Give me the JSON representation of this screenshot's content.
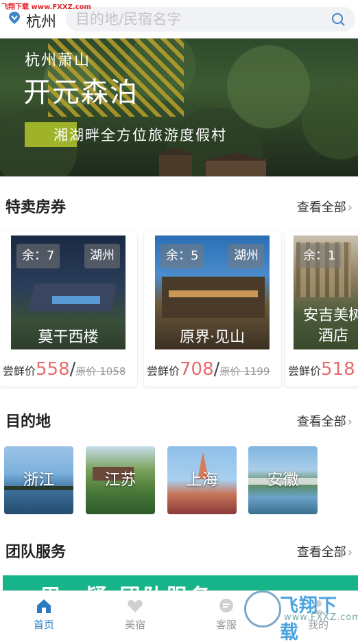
{
  "watermark_top": "飞翔下载 www.FXXZ.com",
  "header": {
    "city": "杭州",
    "search_placeholder": "目的地/民宿名字"
  },
  "banner": {
    "subtitle": "杭州萧山",
    "title": "开元森泊",
    "tagline": "湘湖畔全方位旅游度假村",
    "dot_count": 8
  },
  "deals": {
    "title": "特卖房券",
    "more": "查看全部",
    "items": [
      {
        "remain": "余：7",
        "region": "湖州",
        "name": "莫干西楼",
        "price_label": "尝鲜价",
        "price": "558",
        "slash": "/",
        "orig": "原价 1058"
      },
      {
        "remain": "余：5",
        "region": "湖州",
        "name": "原界·见山",
        "price_label": "尝鲜价",
        "price": "708",
        "slash": "/",
        "orig": "原价 1199"
      },
      {
        "remain": "余：1",
        "region": "",
        "name": "安吉美树酒店",
        "price_label": "尝鲜价",
        "price": "518",
        "slash": "",
        "orig": ""
      }
    ]
  },
  "destinations": {
    "title": "目的地",
    "more": "查看全部",
    "items": [
      {
        "name": "浙江"
      },
      {
        "name": "江苏"
      },
      {
        "name": "上海"
      },
      {
        "name": "安徽"
      }
    ]
  },
  "team": {
    "title": "团队服务",
    "more": "查看全部",
    "banner_text": "一用一疑 团队服务"
  },
  "tabs": [
    {
      "label": "首页",
      "active": true
    },
    {
      "label": "美宿",
      "active": false
    },
    {
      "label": "客服",
      "active": false
    },
    {
      "label": "我的",
      "active": false
    }
  ],
  "watermark_logo": {
    "text": "飞翔下载",
    "url": "www.FXXZ.com"
  },
  "colors": {
    "accent_price": "#e86a6a",
    "tab_active": "#2d7cc2",
    "team_green": "#17b48a",
    "banner_tag": "#9fb32a"
  }
}
